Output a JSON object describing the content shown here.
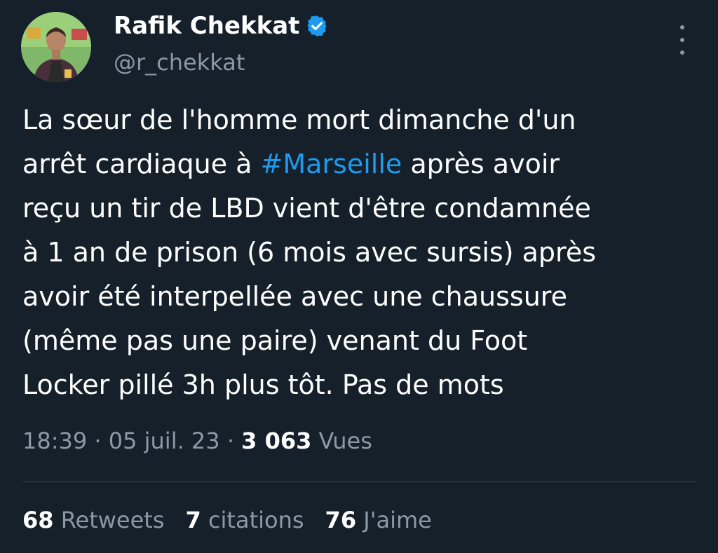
{
  "author": {
    "name": "Rafik Chekkat",
    "handle": "@r_chekkat",
    "verified": true
  },
  "tweet": {
    "lines": [
      [
        {
          "text": "La sœur de l'homme mort dimanche d'un"
        }
      ],
      [
        {
          "text": "arrêt cardiaque à "
        },
        {
          "hashtag": "#Marseille"
        },
        {
          "text": " après avoir"
        }
      ],
      [
        {
          "text": "reçu un tir de LBD vient d'être condamnée"
        }
      ],
      [
        {
          "text": "à 1 an de prison (6 mois avec sursis) après"
        }
      ],
      [
        {
          "text": "avoir été interpellée avec une chaussure"
        }
      ],
      [
        {
          "text": "(même pas une paire) venant du Foot"
        }
      ],
      [
        {
          "text": "Locker pillé 3h plus tôt. Pas de mots"
        }
      ]
    ]
  },
  "meta": {
    "time": "18:39",
    "separator": " · ",
    "date": "05 juil. 23",
    "views_count": "3 063",
    "views_label": " Vues"
  },
  "stats": {
    "retweets_count": "68",
    "retweets_label": " Retweets",
    "quotes_count": "7",
    "quotes_label": " citations",
    "likes_count": "76",
    "likes_label": " J'aime"
  },
  "colors": {
    "background": "#15202b",
    "primary_text": "#ffffff",
    "secondary_text": "#8b98a5",
    "accent": "#1d9bf0",
    "divider": "#38444d"
  },
  "icons": {
    "verified": "verified-badge-icon",
    "more": "more-options-icon"
  }
}
